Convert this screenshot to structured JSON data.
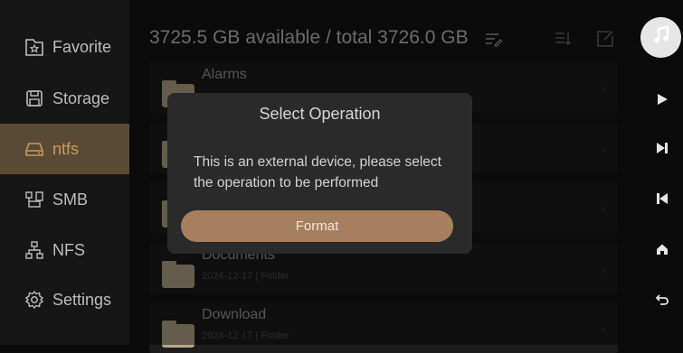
{
  "sidebar": {
    "items": [
      {
        "label": "Favorite",
        "icon": "star-icon"
      },
      {
        "label": "Storage",
        "icon": "save-icon"
      },
      {
        "label": "ntfs",
        "icon": "drive-icon",
        "active": true
      },
      {
        "label": "SMB",
        "icon": "network-share-icon"
      },
      {
        "label": "NFS",
        "icon": "network-tree-icon"
      },
      {
        "label": "Settings",
        "icon": "gear-icon"
      }
    ]
  },
  "header": {
    "storage_text": "3725.5 GB available / total 3726.0 GB"
  },
  "files": [
    {
      "name": "Alarms",
      "meta": ""
    },
    {
      "name": "",
      "meta": ""
    },
    {
      "name": "",
      "meta": ""
    },
    {
      "name": "Documents",
      "meta": "2024-12-17 | Folder"
    },
    {
      "name": "Download",
      "meta": "2024-12-17 | Folder"
    }
  ],
  "dialog": {
    "title": "Select Operation",
    "message": "This is an external device, please select the operation to be performed",
    "button_label": "Format"
  },
  "colors": {
    "accent": "#a67f5e",
    "active_bg": "#5a4a35",
    "active_text": "#c89a5e"
  }
}
